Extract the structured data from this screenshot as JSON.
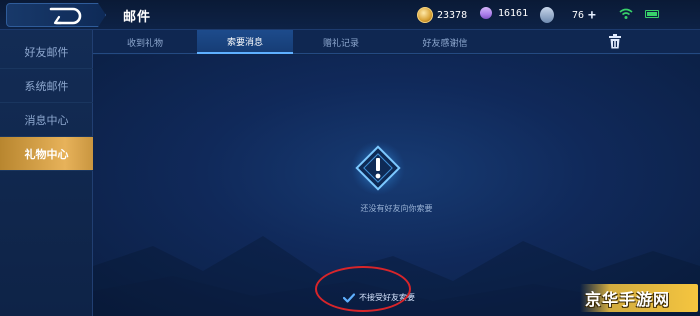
{
  "header": {
    "title": "邮件",
    "resources": {
      "coins": "23378",
      "diamonds": "16161",
      "tickets": "76"
    },
    "plus_label": "+"
  },
  "sidebar": {
    "items": [
      {
        "label": "好友邮件",
        "active": false
      },
      {
        "label": "系统邮件",
        "active": false
      },
      {
        "label": "消息中心",
        "active": false
      },
      {
        "label": "礼物中心",
        "active": true
      }
    ]
  },
  "tabs": [
    {
      "label": "收到礼物",
      "active": false
    },
    {
      "label": "索要消息",
      "active": true
    },
    {
      "label": "赠礼记录",
      "active": false
    },
    {
      "label": "好友感谢信",
      "active": false
    }
  ],
  "main": {
    "empty_text": "还没有好友向你索要",
    "reject_label": "不接受好友索要",
    "reject_checked": true
  },
  "watermark": "京华手游网",
  "colors": {
    "accent_gold": "#e7b25a",
    "tab_highlight": "#5fb0ff",
    "annotation_red": "#d8252a",
    "battery_green": "#38d16a"
  },
  "icons": [
    "back-icon",
    "coin-icon",
    "diamond-icon",
    "ticket-icon",
    "plus-icon",
    "wifi-icon",
    "battery-icon",
    "trash-icon",
    "alert-icon",
    "check-icon"
  ]
}
